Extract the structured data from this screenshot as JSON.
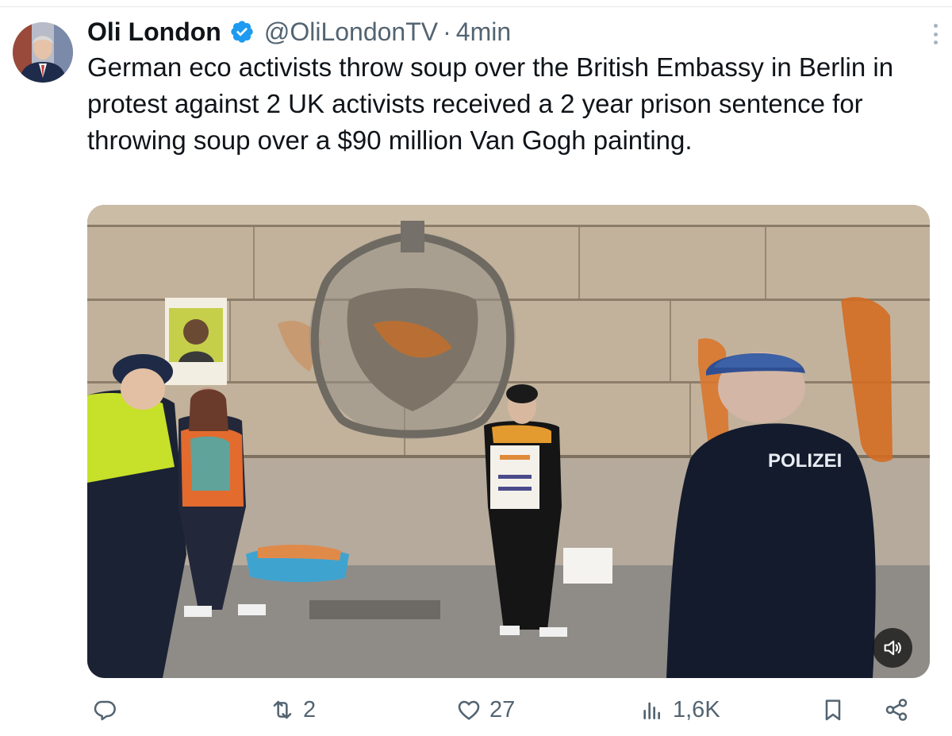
{
  "author": {
    "display_name": "Oli London",
    "handle": "@OliLondonTV",
    "separator": "·",
    "timestamp": "4min",
    "verified": true,
    "avatar_icon": "profile-photo"
  },
  "tweet": {
    "text": "German eco activists throw soup over the British Embassy in Berlin in protest against 2 UK activists received a 2 year prison sentence for throwing soup over a $90 million Van Gogh painting."
  },
  "media": {
    "type": "video",
    "sign_text": "POLIZEI",
    "mute_icon": "speaker-muted-icon"
  },
  "actions": {
    "reply": {
      "icon": "reply-icon",
      "count": ""
    },
    "retweet": {
      "icon": "retweet-icon",
      "count": "2"
    },
    "like": {
      "icon": "heart-icon",
      "count": "27"
    },
    "views": {
      "icon": "views-bar-chart-icon",
      "count": "1,6K"
    },
    "bookmark": {
      "icon": "bookmark-icon",
      "count": ""
    },
    "share": {
      "icon": "share-icon",
      "count": ""
    }
  },
  "colors": {
    "text_primary": "#0f1419",
    "text_secondary": "#536471",
    "verified_blue": "#1d9bf0",
    "border": "#e6e9ec"
  }
}
